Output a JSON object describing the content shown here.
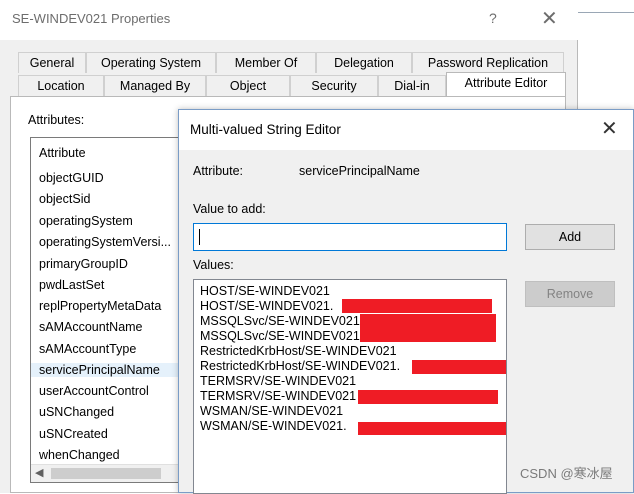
{
  "properties_window": {
    "title": "SE-WINDEV021 Properties",
    "help_glyph": "?",
    "close_glyph": "✕",
    "tabs_row1": [
      "General",
      "Operating System",
      "Member Of",
      "Delegation",
      "Password Replication"
    ],
    "tabs_row2": [
      "Location",
      "Managed By",
      "Object",
      "Security",
      "Dial-in",
      "Attribute Editor"
    ],
    "active_tab": "Attribute Editor",
    "attributes_label": "Attributes:",
    "list_header": "Attribute",
    "attributes": [
      "objectGUID",
      "objectSid",
      "operatingSystem",
      "operatingSystemVersi...",
      "primaryGroupID",
      "pwdLastSet",
      "replPropertyMetaData",
      "sAMAccountName",
      "sAMAccountType",
      "servicePrincipalName",
      "userAccountControl",
      "uSNChanged",
      "uSNCreated",
      "whenChanged"
    ],
    "selected_attribute": "servicePrincipalName"
  },
  "dialog": {
    "title": "Multi-valued String Editor",
    "close_glyph": "✕",
    "attribute_label": "Attribute:",
    "attribute_value": "servicePrincipalName",
    "value_to_add_label": "Value to add:",
    "value_to_add": "",
    "add_button": "Add",
    "values_label": "Values:",
    "remove_button": "Remove",
    "values": [
      "HOST/SE-WINDEV021",
      "HOST/SE-WINDEV021.",
      "MSSQLSvc/SE-WINDEV021",
      "MSSQLSvc/SE-WINDEV021",
      "RestrictedKrbHost/SE-WINDEV021",
      "RestrictedKrbHost/SE-WINDEV021.",
      "TERMSRV/SE-WINDEV021",
      "TERMSRV/SE-WINDEV021",
      "WSMAN/SE-WINDEV021",
      "WSMAN/SE-WINDEV021."
    ]
  },
  "watermark": "CSDN @寒冰屋",
  "colors": {
    "redaction": "#ef1c25",
    "selection": "#e5f1fb",
    "focus_border": "#0078d7"
  }
}
